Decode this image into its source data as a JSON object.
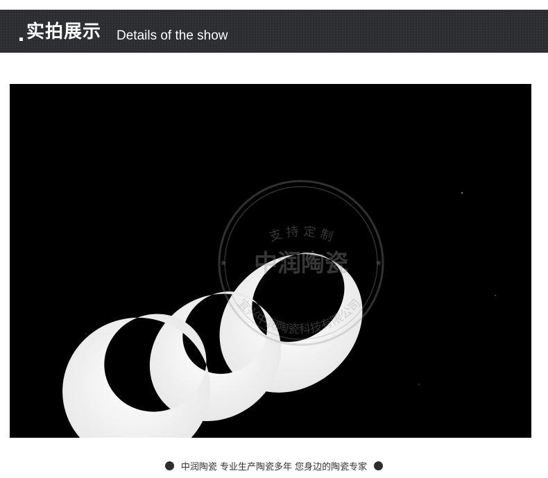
{
  "header": {
    "title": "实拍展示",
    "subtitle": "Details of the show"
  },
  "photo": {
    "watermark": {
      "center_text": "中润陶瓷",
      "top_arc_text": "支 持 定 制",
      "bottom_arc_text": "宜兴中润陶瓷科技有限公司"
    }
  },
  "footer": {
    "text": "中润陶瓷 专业生产陶瓷多年 您身边的陶瓷专家"
  },
  "colors": {
    "header_bg": "#2b2d31",
    "photo_bg": "#000000",
    "ring": "#f2f2f2",
    "footer_dot": "#2b2d31"
  }
}
